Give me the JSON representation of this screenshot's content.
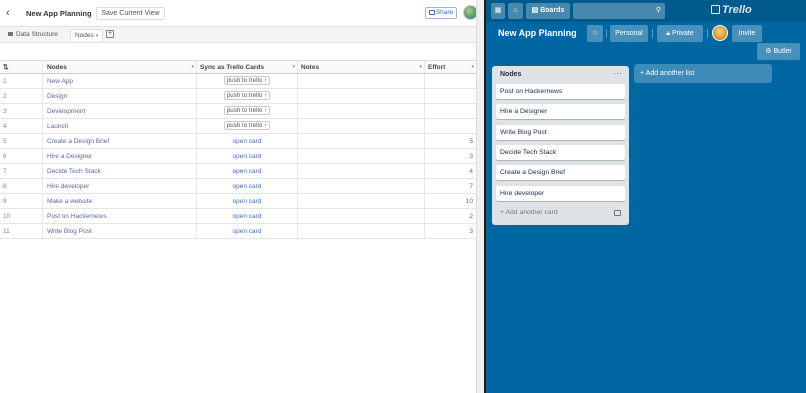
{
  "left": {
    "title": "New App Planning",
    "save_view_label": "Save Current View",
    "share_label": "Share",
    "tabs": [
      {
        "label": "Data Structure"
      },
      {
        "label": "Nodes"
      }
    ],
    "columns": [
      "Nodes",
      "Sync as Trello Cards",
      "Notes",
      "Effort"
    ],
    "rows": [
      {
        "idx": "1",
        "node": "New App",
        "sync": "push to trello",
        "sync_type": "push",
        "effort": ""
      },
      {
        "idx": "2",
        "node": "Design",
        "sync": "push to trello",
        "sync_type": "push",
        "effort": ""
      },
      {
        "idx": "3",
        "node": "Development",
        "sync": "push to trello",
        "sync_type": "push",
        "effort": ""
      },
      {
        "idx": "4",
        "node": "Launch",
        "sync": "push to trello",
        "sync_type": "push",
        "effort": ""
      },
      {
        "idx": "5",
        "node": "Create a Design Brief",
        "sync": "open card",
        "sync_type": "open",
        "effort": "5"
      },
      {
        "idx": "6",
        "node": "Hire a Designer",
        "sync": "open card",
        "sync_type": "open",
        "effort": "3"
      },
      {
        "idx": "7",
        "node": "Decide Tech Stack",
        "sync": "open card",
        "sync_type": "open",
        "effort": "4"
      },
      {
        "idx": "8",
        "node": "Hire developer",
        "sync": "open card",
        "sync_type": "open",
        "effort": "7"
      },
      {
        "idx": "9",
        "node": "Make a website",
        "sync": "open card",
        "sync_type": "open",
        "effort": "10"
      },
      {
        "idx": "10",
        "node": "Post on Hackernews",
        "sync": "open card",
        "sync_type": "open",
        "effort": "2"
      },
      {
        "idx": "11",
        "node": "Write Blog Post",
        "sync": "open card",
        "sync_type": "open",
        "effort": "3"
      }
    ]
  },
  "trello": {
    "nav": {
      "boards_label": "Boards",
      "logo_text": "Trello"
    },
    "board_title": "New App Planning",
    "personal_label": "Personal",
    "private_label": "Private",
    "invite_label": "Invite",
    "butler_label": "Butler",
    "list": {
      "title": "Nodes",
      "cards": [
        "Post on Hackernews",
        "Hire a Designer",
        "Write Blog Post",
        "Decide Tech Stack",
        "Create a Design Brief",
        "Hire developer"
      ],
      "add_card_label": "Add another card"
    },
    "add_list_label": "Add another list",
    "colors": {
      "board_bg": "#0067a3",
      "nav_bg": "#005a8e",
      "link": "#3b6fd4"
    }
  }
}
